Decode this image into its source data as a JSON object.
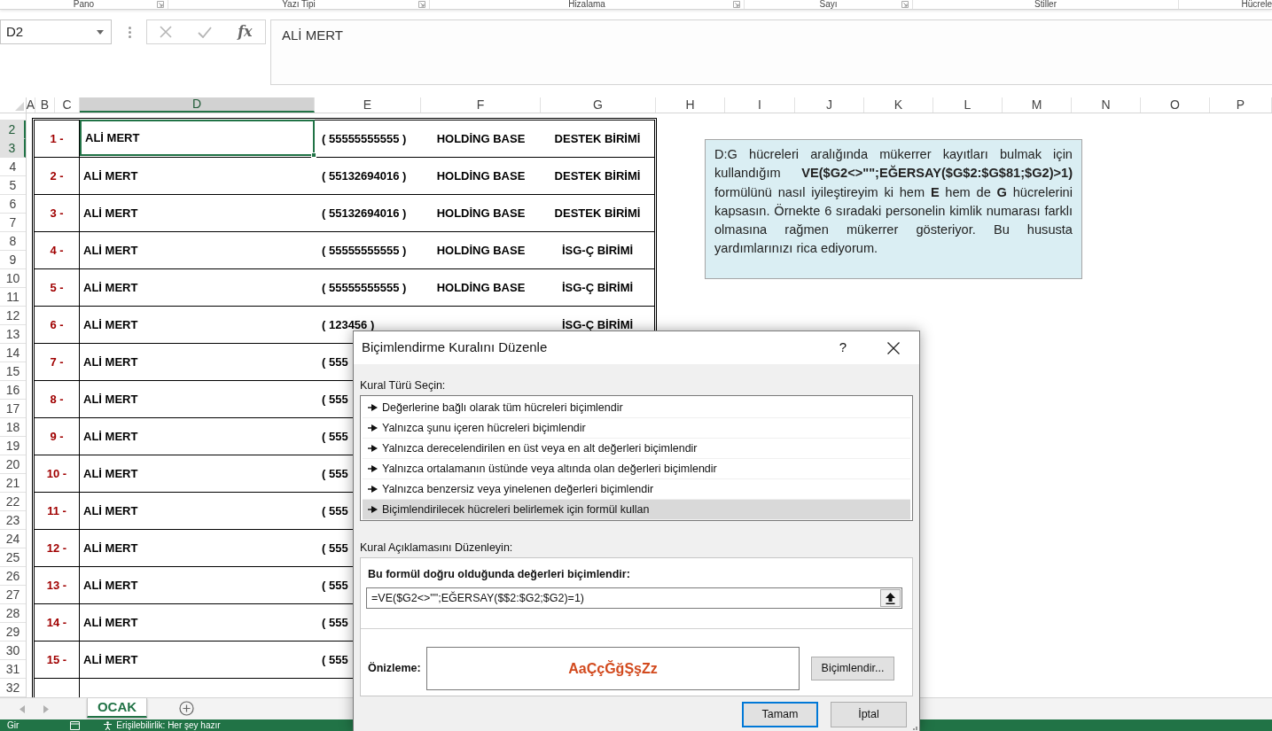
{
  "ribbon": {
    "groups": [
      {
        "label": "Pano",
        "launcher": true
      },
      {
        "label": "Yazı Tipi",
        "launcher": true
      },
      {
        "label": "Hizalama",
        "launcher": true
      },
      {
        "label": "Sayı",
        "launcher": true
      },
      {
        "label": "Stiller",
        "launcher": false
      },
      {
        "label": "Hücrele",
        "launcher": false
      }
    ]
  },
  "formula_bar": {
    "name_box": "D2",
    "function_button": "fx",
    "formula": "ALİ MERT"
  },
  "columns": [
    {
      "label": "A",
      "selected": false
    },
    {
      "label": "B",
      "selected": false
    },
    {
      "label": "C",
      "selected": false
    },
    {
      "label": "D",
      "selected": true
    },
    {
      "label": "E",
      "selected": false
    },
    {
      "label": "F",
      "selected": false
    },
    {
      "label": "G",
      "selected": false
    },
    {
      "label": "H",
      "selected": false
    },
    {
      "label": "I",
      "selected": false
    },
    {
      "label": "J",
      "selected": false
    },
    {
      "label": "K",
      "selected": false
    },
    {
      "label": "L",
      "selected": false
    },
    {
      "label": "M",
      "selected": false
    },
    {
      "label": "N",
      "selected": false
    },
    {
      "label": "O",
      "selected": false
    },
    {
      "label": "P",
      "selected": false
    }
  ],
  "row_headers": [
    {
      "label": "2",
      "selected": true
    },
    {
      "label": "3",
      "selected": true
    },
    {
      "label": "4",
      "selected": false
    },
    {
      "label": "5",
      "selected": false
    },
    {
      "label": "6",
      "selected": false
    },
    {
      "label": "7",
      "selected": false
    },
    {
      "label": "8",
      "selected": false
    },
    {
      "label": "9",
      "selected": false
    },
    {
      "label": "10",
      "selected": false
    },
    {
      "label": "11",
      "selected": false
    },
    {
      "label": "12",
      "selected": false
    },
    {
      "label": "13",
      "selected": false
    },
    {
      "label": "14",
      "selected": false
    },
    {
      "label": "15",
      "selected": false
    },
    {
      "label": "16",
      "selected": false
    },
    {
      "label": "17",
      "selected": false
    },
    {
      "label": "18",
      "selected": false
    },
    {
      "label": "19",
      "selected": false
    },
    {
      "label": "20",
      "selected": false
    },
    {
      "label": "21",
      "selected": false
    },
    {
      "label": "22",
      "selected": false
    },
    {
      "label": "23",
      "selected": false
    },
    {
      "label": "24",
      "selected": false
    },
    {
      "label": "25",
      "selected": false
    },
    {
      "label": "26",
      "selected": false
    },
    {
      "label": "27",
      "selected": false
    },
    {
      "label": "28",
      "selected": false
    },
    {
      "label": "29",
      "selected": false
    },
    {
      "label": "30",
      "selected": false
    },
    {
      "label": "31",
      "selected": false
    },
    {
      "label": "32",
      "selected": false
    }
  ],
  "table": {
    "rows": [
      {
        "column_1": "1 -",
        "column_2": "ALİ MERT",
        "column_3": "( 55555555555 )",
        "column_4": "HOLDİNG BASE",
        "column_5": "DESTEK BİRİMİ",
        "selected": true
      },
      {
        "column_1": "2 -",
        "column_2": "ALİ MERT",
        "column_3": "( 55132694016 )",
        "column_4": "HOLDİNG BASE",
        "column_5": "DESTEK BİRİMİ",
        "selected": false
      },
      {
        "column_1": "3 -",
        "column_2": "ALİ MERT",
        "column_3": "( 55132694016 )",
        "column_4": "HOLDİNG BASE",
        "column_5": "DESTEK BİRİMİ",
        "selected": false
      },
      {
        "column_1": "4 -",
        "column_2": "ALİ MERT",
        "column_3": "( 55555555555 )",
        "column_4": "HOLDİNG BASE",
        "column_5": "İSG-Ç BİRİMİ",
        "selected": false
      },
      {
        "column_1": "5 -",
        "column_2": "ALİ MERT",
        "column_3": "( 55555555555 )",
        "column_4": "HOLDİNG BASE",
        "column_5": "İSG-Ç BİRİMİ",
        "selected": false
      },
      {
        "column_1": "6 -",
        "column_2": "ALİ MERT",
        "column_3": "( 123456 )",
        "column_5": "İSG-Ç BİRİMİ",
        "selected": false
      },
      {
        "column_1": "7 -",
        "column_2": "ALİ MERT",
        "column_3": "( 555",
        "selected": false
      },
      {
        "column_1": "8 -",
        "column_2": "ALİ MERT",
        "column_3": "( 555",
        "selected": false
      },
      {
        "column_1": "9 -",
        "column_2": "ALİ MERT",
        "column_3": "( 555",
        "selected": false
      },
      {
        "column_1": "10 -",
        "column_2": "ALİ MERT",
        "column_3": "( 555",
        "selected": false
      },
      {
        "column_1": "11 -",
        "column_2": "ALİ MERT",
        "column_3": "( 555",
        "selected": false
      },
      {
        "column_1": "12 -",
        "column_2": "ALİ MERT",
        "column_3": "( 555",
        "selected": false
      },
      {
        "column_1": "13 -",
        "column_2": "ALİ MERT",
        "column_3": "( 555",
        "selected": false
      },
      {
        "column_1": "14 -",
        "column_2": "ALİ MERT",
        "column_3": "( 555",
        "selected": false
      },
      {
        "column_1": "15 -",
        "column_2": "ALİ MERT",
        "column_3": "( 555",
        "selected": false
      }
    ]
  },
  "note": {
    "text": "D:G hücreleri aralığında mükerrer kayıtları bulmak için kullandığım **VE($G2<>\"\";EĞERSAY($G$2:$G$81;$G2)>1)** formülünü nasıl iyileştireyim ki hem **E** hem de **G** hücrelerini kapsasın. Örnekte 6 sıradaki personelin kimlik numarası farklı olmasına rağmen mükerrer gösteriyor. Bu hususta yardımlarınızı rica ediyorum."
  },
  "dialog": {
    "title": "Biçimlendirme Kuralını Düzenle",
    "help_button": "?",
    "rule_type_label": "Kural Türü Seçin:",
    "rule_types": [
      {
        "label": "Değerlerine bağlı olarak tüm hücreleri biçimlendir",
        "selected": false
      },
      {
        "label": "Yalnızca şunu içeren hücreleri biçimlendir",
        "selected": false
      },
      {
        "label": "Yalnızca derecelendirilen en üst veya en alt değerleri biçimlendir",
        "selected": false
      },
      {
        "label": "Yalnızca ortalamanın üstünde veya altında olan değerleri biçimlendir",
        "selected": false
      },
      {
        "label": "Yalnızca benzersiz veya yinelenen değerleri biçimlendir",
        "selected": false
      },
      {
        "label": "Biçimlendirilecek hücreleri belirlemek için formül kullan",
        "selected": true
      }
    ],
    "description_label": "Kural Açıklamasını Düzenleyin:",
    "formula_label": "Bu formül doğru olduğunda değerleri biçimlendir:",
    "formula": "=VE($G2<>\"\";EĞERSAY($$2:$G2;$G2)=1)",
    "preview_label": "Önizleme:",
    "preview_text": "AaÇçĞğŞşZz",
    "format_button": "Biçimlendir...",
    "buttons": [
      {
        "label": "Tamam",
        "focused": true
      },
      {
        "label": "İptal",
        "focused": false
      }
    ]
  },
  "sheet_tabs": [
    {
      "label": "OCAK",
      "selected": true
    }
  ],
  "status_bar": {
    "mode": "Gir",
    "accessibility": "Erişilebilirlik: Her şey hazır"
  }
}
